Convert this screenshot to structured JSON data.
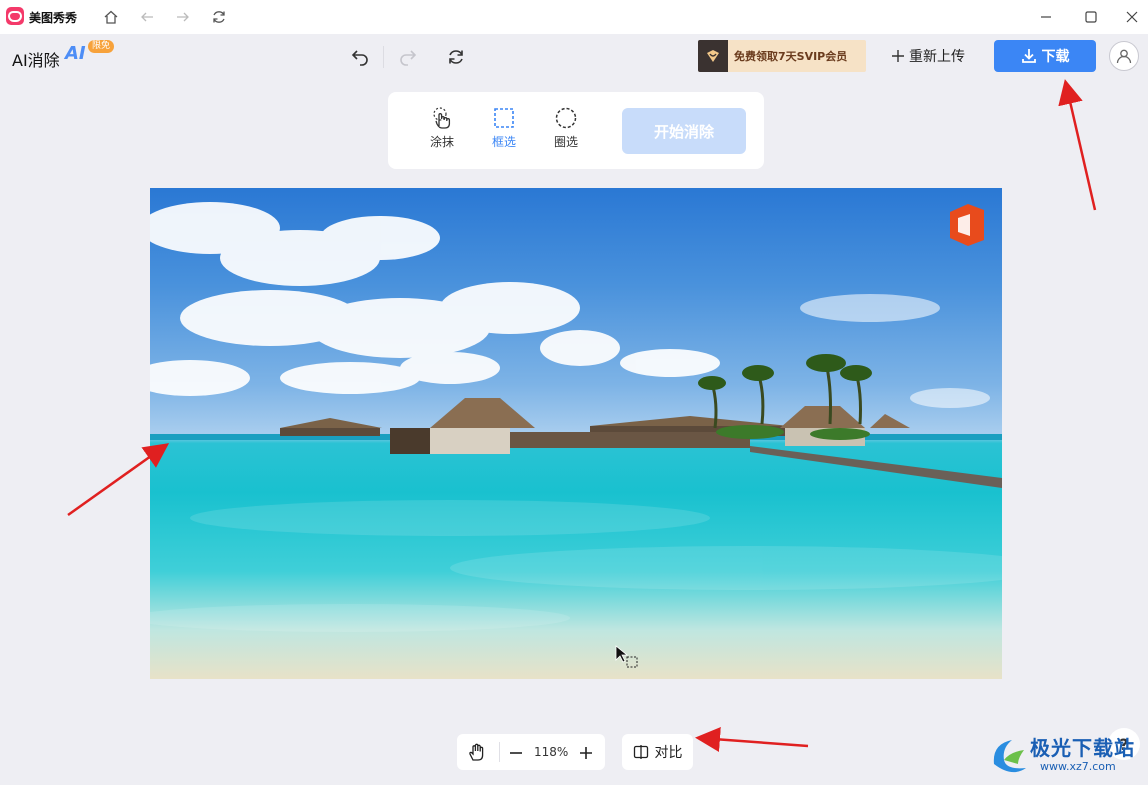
{
  "titlebar": {
    "app_name": "美图秀秀",
    "icons": [
      "home-icon",
      "back-arrow-icon",
      "forward-arrow-icon",
      "refresh-icon",
      "minimize-icon",
      "maximize-icon"
    ]
  },
  "toolbar": {
    "feature_title": "AI消除",
    "ai_badge": "AI",
    "free_tag": "限免",
    "vip_promo": "免费领取7天SVIP会员",
    "reupload_label": "重新上传",
    "download_label": "下载"
  },
  "tools": {
    "smear_label": "涂抹",
    "box_select_label": "框选",
    "lasso_label": "圈选",
    "start_label": "开始消除",
    "active_tool": "框选"
  },
  "bottom": {
    "zoom_value": "118%",
    "compare_label": "对比",
    "help_label": "?"
  },
  "watermark": {
    "title": "极光下载站",
    "url": "www.xz7.com"
  },
  "colors": {
    "accent": "#3b86f5",
    "start_disabled": "#c8dcfa",
    "annotation_arrow": "#e02020",
    "logo": "#f43a6a"
  }
}
